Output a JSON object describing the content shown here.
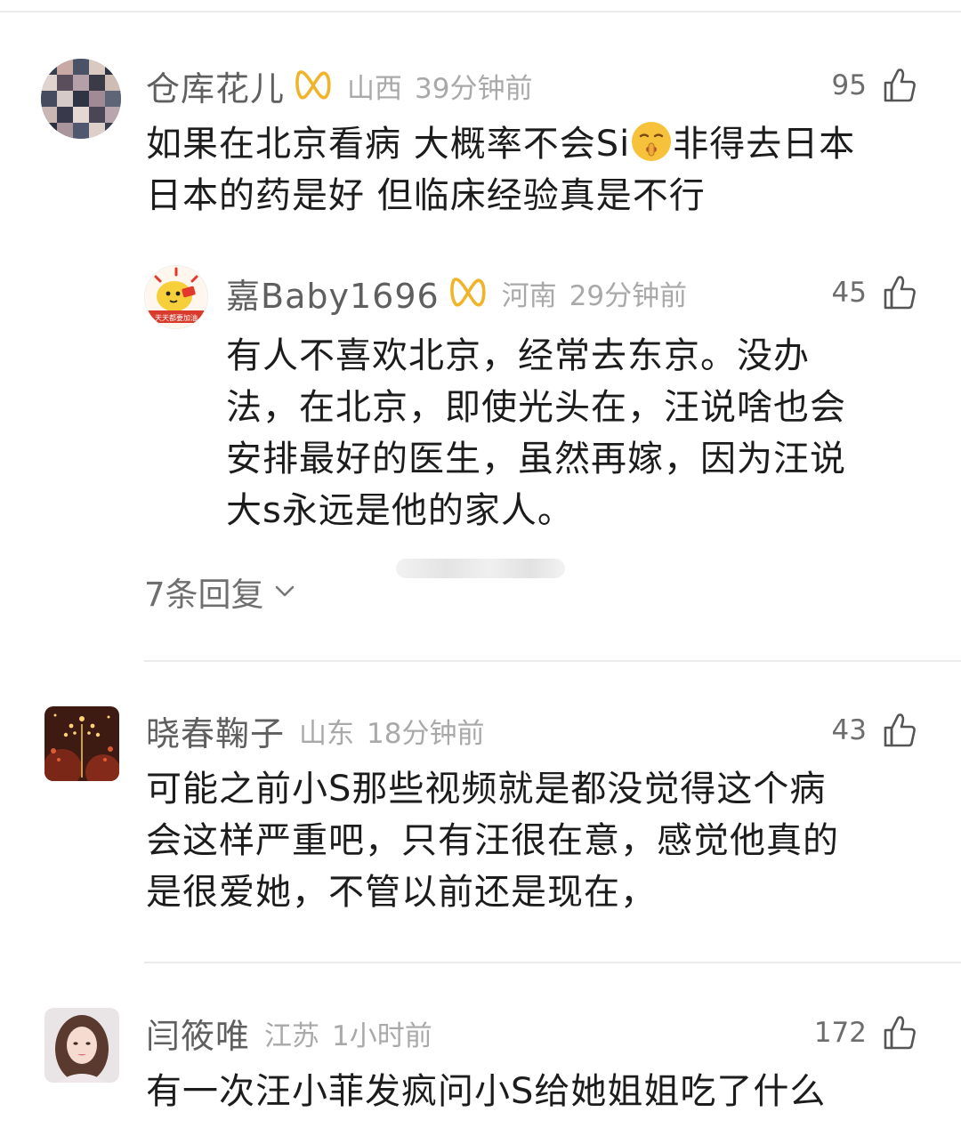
{
  "comments": [
    {
      "username": "仓库花儿",
      "vip_badge": true,
      "location": "山西",
      "time": "39分钟前",
      "likes": "95",
      "text_lines": [
        "如果在北京看病 大概率不会Si",
        "非得去日本",
        "日本的药是好 但临床经验真是不行"
      ],
      "emoji": "shushing-face-emoji",
      "avatar": "collage-avatar",
      "reply": {
        "username": "嘉Baby1696",
        "vip_badge": true,
        "location": "河南",
        "time": "29分钟前",
        "likes": "45",
        "avatar_caption": "天天都要加油",
        "avatar": "yellow-cartoon-avatar",
        "text_lines": [
          "有人不喜欢北京，经常去东京。没办",
          "法，在北京，即使光头在，汪说啥也会",
          "安排最好的医生，虽然再嫁，因为汪说",
          "大s永远是他的家人。"
        ]
      },
      "replies_label": "7条回复"
    },
    {
      "username": "晓春鞠子",
      "vip_badge": false,
      "location": "山东",
      "time": "18分钟前",
      "likes": "43",
      "avatar": "festive-lights-avatar",
      "text_lines": [
        "可能之前小S那些视频就是都没觉得这个病",
        "会这样严重吧，只有汪很在意，感觉他真的",
        "是很爱她，不管以前还是现在，"
      ]
    },
    {
      "username": "闫筱唯",
      "vip_badge": false,
      "location": "江苏",
      "time": "1小时前",
      "likes": "172",
      "avatar": "woman-portrait-avatar",
      "text_lines": [
        "有一次汪小菲发疯问小S给她姐姐吃了什么"
      ]
    }
  ],
  "icons": {
    "like": "thumbs-up-icon",
    "vip": "gold-vip-badge-icon",
    "chevron": "chevron-down-icon"
  },
  "colors": {
    "username": "#5f5f5f",
    "meta": "#a9a9a9",
    "vip_gold": "#f0b42a",
    "text": "#1c1c1c"
  }
}
